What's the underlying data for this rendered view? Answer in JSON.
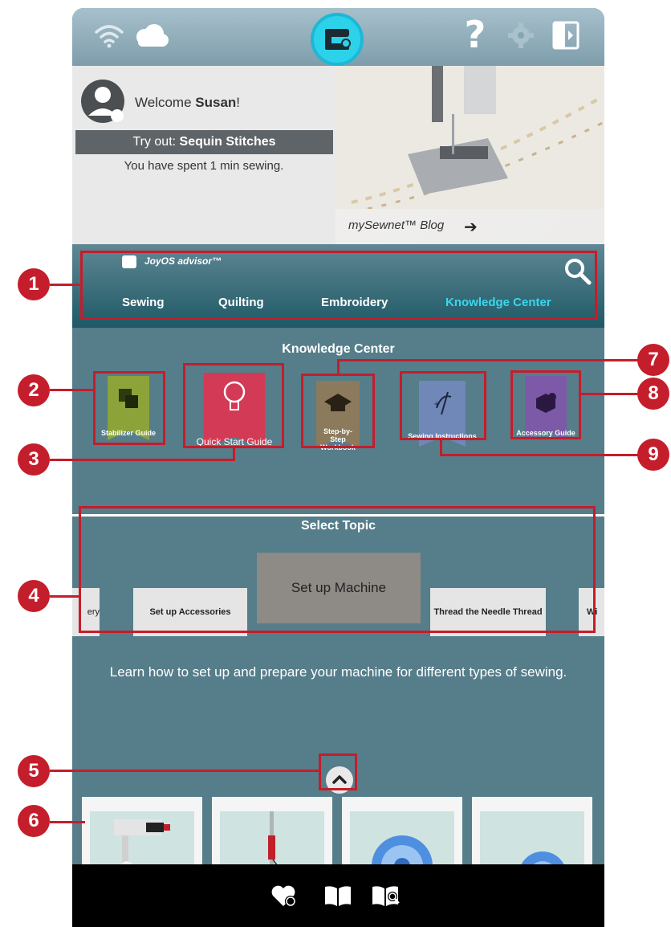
{
  "status_bar": {
    "icons": [
      "wifi-icon",
      "cloud-icon",
      "sewing-machine-icon",
      "help-icon",
      "settings-icon",
      "exit-icon"
    ],
    "help_glyph": "?"
  },
  "welcome": {
    "greeting_prefix": "Welcome ",
    "user_name": "Susan",
    "greeting_suffix": "!",
    "tryout_prefix": "Try out: ",
    "tryout_item": "Sequin Stitches",
    "time_spent": "You have spent 1 min sewing."
  },
  "blog": {
    "label": "mySewnet™ Blog",
    "arrow": "➔"
  },
  "advisor": {
    "title": "JoyOS advisor™",
    "nav": [
      "Sewing",
      "Quilting",
      "Embroidery",
      "Knowledge Center"
    ],
    "active_nav": "Knowledge Center"
  },
  "knowledge_center": {
    "title": "Knowledge Center",
    "guides": [
      {
        "label": "Stabilizer Guide",
        "color": "#8ca33a"
      },
      {
        "label": "Quick Start Guide",
        "color": "#d23a55"
      },
      {
        "label": "Step-by-Step Workbook",
        "color": "#8b7a5c"
      },
      {
        "label": "Sewing Instructions",
        "color": "#6f88b8"
      },
      {
        "label": "Accessory Guide",
        "color": "#7c5aa8"
      }
    ]
  },
  "topic": {
    "title": "Select Topic",
    "items": [
      "ery",
      "Set up Accessories",
      "Set up Machine",
      "Thread the Needle Thread",
      "Wi"
    ],
    "selected": "Set up Machine",
    "description": "Learn how to set up and prepare your machine for different types of sewing."
  },
  "bottom_bar": {
    "icons": [
      "favorites-icon",
      "book-icon",
      "book-search-icon"
    ]
  },
  "callouts": [
    "1",
    "2",
    "3",
    "4",
    "5",
    "6",
    "7",
    "8",
    "9"
  ],
  "colors": {
    "accent": "#3ad7ef",
    "callout": "#c41d2b",
    "panel": "#567d8a"
  }
}
